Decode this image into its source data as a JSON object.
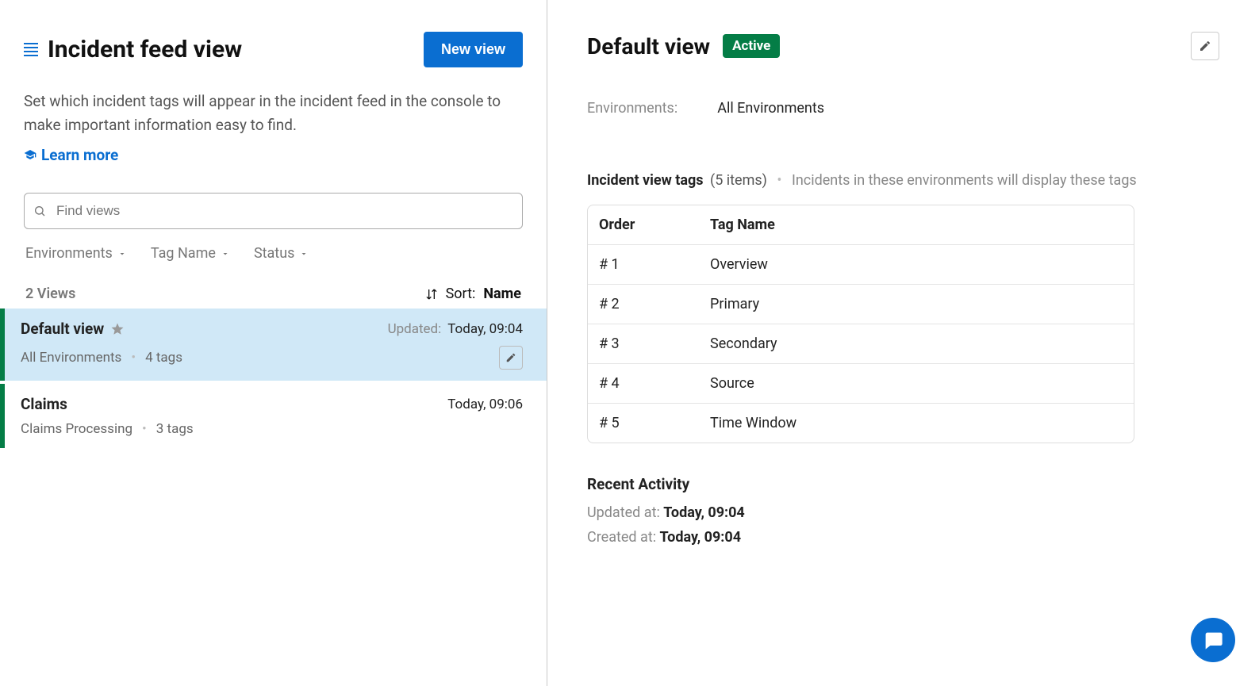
{
  "left": {
    "title": "Incident feed view",
    "new_view_label": "New view",
    "description": "Set which incident tags will appear in the incident feed in the console to make important information easy to find.",
    "learn_more_label": "Learn more",
    "search_placeholder": "Find views",
    "filters": {
      "environments": "Environments",
      "tag_name": "Tag Name",
      "status": "Status"
    },
    "view_count_label": "2 Views",
    "sort_label": "Sort:",
    "sort_value": "Name"
  },
  "views": [
    {
      "name": "Default view",
      "starred": true,
      "updated_label": "Updated:",
      "updated_time": "Today, 09:04",
      "sub_env": "All Environments",
      "sub_tags": "4 tags",
      "selected": true
    },
    {
      "name": "Claims",
      "starred": false,
      "updated_label": "",
      "updated_time": "Today, 09:06",
      "sub_env": "Claims Processing",
      "sub_tags": "3 tags",
      "selected": false
    }
  ],
  "detail": {
    "title": "Default view",
    "status_badge": "Active",
    "env_label": "Environments:",
    "env_value": "All Environments",
    "tags_title": "Incident view tags",
    "tags_count": "(5 items)",
    "tags_note": "Incidents in these environments will display these tags",
    "columns": {
      "order": "Order",
      "tag_name": "Tag Name"
    },
    "rows": [
      {
        "order": "# 1",
        "tag": "Overview"
      },
      {
        "order": "# 2",
        "tag": "Primary"
      },
      {
        "order": "# 3",
        "tag": "Secondary"
      },
      {
        "order": "# 4",
        "tag": "Source"
      },
      {
        "order": "# 5",
        "tag": "Time Window"
      }
    ],
    "activity_title": "Recent Activity",
    "updated_at_label": "Updated at: ",
    "updated_at_value": "Today, 09:04",
    "created_at_label": "Created at: ",
    "created_at_value": "Today, 09:04"
  }
}
